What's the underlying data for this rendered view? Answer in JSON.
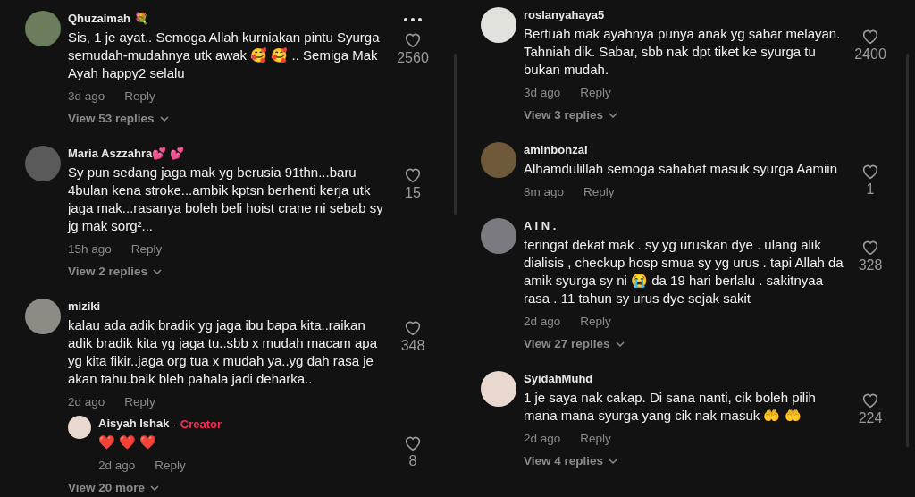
{
  "columns": [
    {
      "comments": [
        {
          "username": "Qhuzaimah 💐",
          "text": "Sis, 1 je ayat.. Semoga Allah kurniakan pintu Syurga semudah-mudahnya utk awak 🥰 🥰 .. Semiga Mak Ayah happy2 selalu",
          "time": "3d ago",
          "reply": "Reply",
          "likes": "2560",
          "view_replies": "View 53 replies"
        },
        {
          "username": "Maria Aszzahra💕 💕",
          "text": "Sy pun sedang jaga mak yg berusia 91thn...baru 4bulan kena stroke...ambik kptsn berhenti kerja utk jaga mak...rasanya boleh beli hoist crane ni sebab sy jg mak sorg²...",
          "time": "15h ago",
          "reply": "Reply",
          "likes": "15",
          "view_replies": "View 2 replies"
        },
        {
          "username": "miziki",
          "text": "kalau ada adik bradik yg jaga ibu bapa kita..raikan adik bradik kita yg jaga tu..sbb x mudah macam apa yg kita fikir..jaga org tua x mudah ya..yg dah rasa je akan tahu.baik bleh pahala jadi deharka..",
          "time": "2d ago",
          "reply": "Reply",
          "likes": "348",
          "replies": [
            {
              "username": "Aisyah Ishak",
              "separator": "·",
              "badge": "Creator",
              "text": "❤️ ❤️ ❤️",
              "time": "2d ago",
              "reply": "Reply",
              "likes": "8"
            }
          ],
          "view_replies": "View 20 more"
        }
      ]
    },
    {
      "comments": [
        {
          "username": "roslanyahaya5",
          "text": "Bertuah mak ayahnya punya anak yg sabar melayan. Tahniah dik. Sabar, sbb nak dpt tiket ke syurga tu bukan mudah.",
          "time": "3d ago",
          "reply": "Reply",
          "likes": "2400",
          "view_replies": "View 3 replies"
        },
        {
          "username": "aminbonzai",
          "text": "Alhamdulillah semoga sahabat masuk syurga Aamiin",
          "time": "8m ago",
          "reply": "Reply",
          "likes": "1"
        },
        {
          "username": "A I N .",
          "text": "teringat dekat mak . sy yg uruskan dye . ulang alik dialisis , checkup hosp smua sy yg urus . tapi Allah da amik syurga sy ni 😭 da 19 hari berlalu . sakitnyaa rasa . 11 tahun sy urus dye sejak sakit",
          "time": "2d ago",
          "reply": "Reply",
          "likes": "328",
          "view_replies": "View 27 replies"
        },
        {
          "username": "SyidahMuhd",
          "text": "1 je saya nak cakap. Di sana nanti, cik boleh pilih mana mana syurga yang cik nak masuk 🤲 🤲",
          "time": "2d ago",
          "reply": "Reply",
          "likes": "224",
          "view_replies": "View 4 replies"
        }
      ]
    }
  ]
}
